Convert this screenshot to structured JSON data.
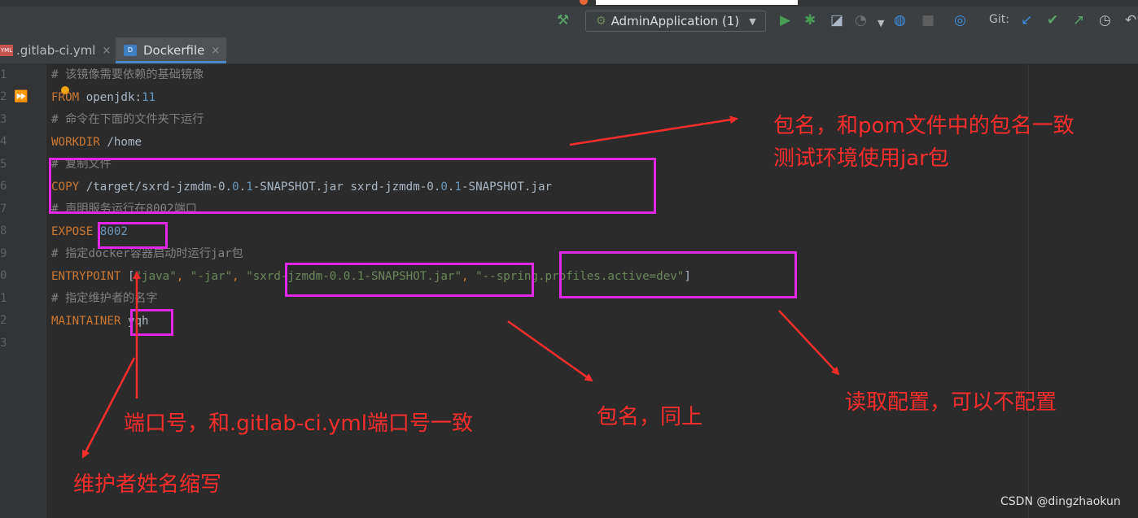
{
  "toolbar": {
    "run_config_label": "AdminApplication (1)",
    "git_label": "Git:",
    "icons": [
      "hammer-icon",
      "run-icon",
      "debug-icon",
      "coverage-icon",
      "profile-icon",
      "more-icon",
      "update-icon",
      "stop-icon",
      "search-icon",
      "git-update-icon",
      "git-commit-icon",
      "git-push-icon",
      "history-icon",
      "rollback-icon"
    ]
  },
  "tabs": [
    {
      "label": ".gitlab-ci.yml",
      "badge": "YML",
      "close": "×"
    },
    {
      "label": "Dockerfile",
      "badge": "D",
      "close": "×"
    }
  ],
  "gutter": {
    "line_numbers": [
      "1",
      "2",
      "3",
      "4",
      "5",
      "6",
      "7",
      "8",
      "9",
      "0",
      "1",
      "2",
      "3"
    ]
  },
  "code": {
    "line1": "# 该镜像需要依赖的基础镜像",
    "line2_kw": "FROM",
    "line2_img": " openjdk",
    "line2_colon": ":",
    "line2_ver": "11",
    "line3": "# 命令在下面的文件夹下运行",
    "line4_kw": "WORKDIR",
    "line4_val": " /home",
    "line5": "# 复制文件",
    "line6_kw": "COPY",
    "line6_a": " /target/sxrd-jzmdm-0.",
    "line6_b": "0",
    "line6_c": ".",
    "line6_d": "1",
    "line6_e": "-SNAPSHOT.jar sxrd-jzmdm-0.",
    "line6_f": "0",
    "line6_g": ".",
    "line6_h": "1",
    "line6_i": "-SNAPSHOT.jar",
    "line7": "# 声明服务运行在8002端口",
    "line8_kw": "EXPOSE",
    "line8_val": "8002",
    "line9": "# 指定docker容器启动时运行jar包",
    "line10_kw": "ENTRYPOINT",
    "line10_br": " [",
    "line10_s1": "\"java\"",
    "line10_c1": ", ",
    "line10_s2": "\"-jar\"",
    "line10_c2": ", ",
    "line10_s3": "\"sxrd-jzmdm-0.0.1-SNAPSHOT.jar\"",
    "line10_c3": ", ",
    "line10_s4": "\"--spring.profiles.active=dev\"",
    "line10_end": "]",
    "line11": "# 指定维护者的名字",
    "line12_kw": "MAINTAINER",
    "line12_val": " yqh"
  },
  "annotations": {
    "package_name_1": "包名，和pom文件中的包名一致",
    "package_name_2": "测试环境使用jar包",
    "port": "端口号，和.gitlab-ci.yml端口号一致",
    "maintainer": "维护者姓名缩写",
    "package_same": "包名，同上",
    "read_config": "读取配置，可以不配置"
  },
  "colors": {
    "annotation_text": "#fa2d2d",
    "highlight_box": "#e028e6",
    "keyword": "#cc7832",
    "comment": "#808080",
    "string": "#6a8759",
    "number": "#6897bb"
  },
  "watermark": "CSDN @dingzhaokun"
}
